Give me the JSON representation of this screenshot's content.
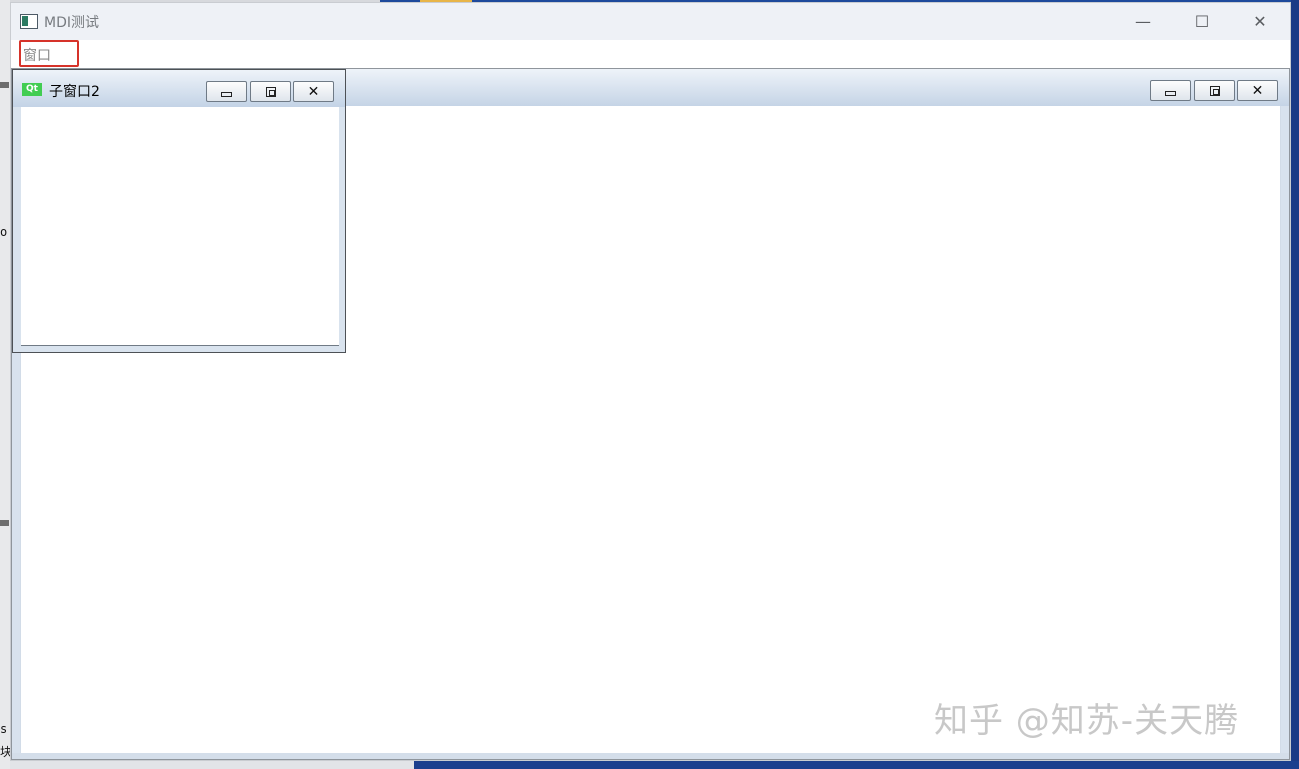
{
  "main_window": {
    "title": "MDI测试",
    "controls": {
      "minimize": "—",
      "maximize": "☐",
      "close": "✕"
    }
  },
  "menubar": {
    "items": [
      {
        "label": "窗口"
      }
    ]
  },
  "mdi": {
    "maximized_frame": {
      "buttons": {
        "minimize": "",
        "restore": "",
        "close": "✕"
      }
    },
    "child_window": {
      "icon_label": "Qt",
      "title": "子窗口2",
      "buttons": {
        "minimize": "",
        "restore": "",
        "close": "✕"
      }
    }
  },
  "watermark": "知乎 @知苏-关天腾",
  "edge_text": {
    "left_mid": "o:",
    "left_bottom_1": "s",
    "left_bottom_2": "块"
  },
  "colors": {
    "menu_highlight": "#d6332a",
    "qt_green": "#41cd52"
  }
}
